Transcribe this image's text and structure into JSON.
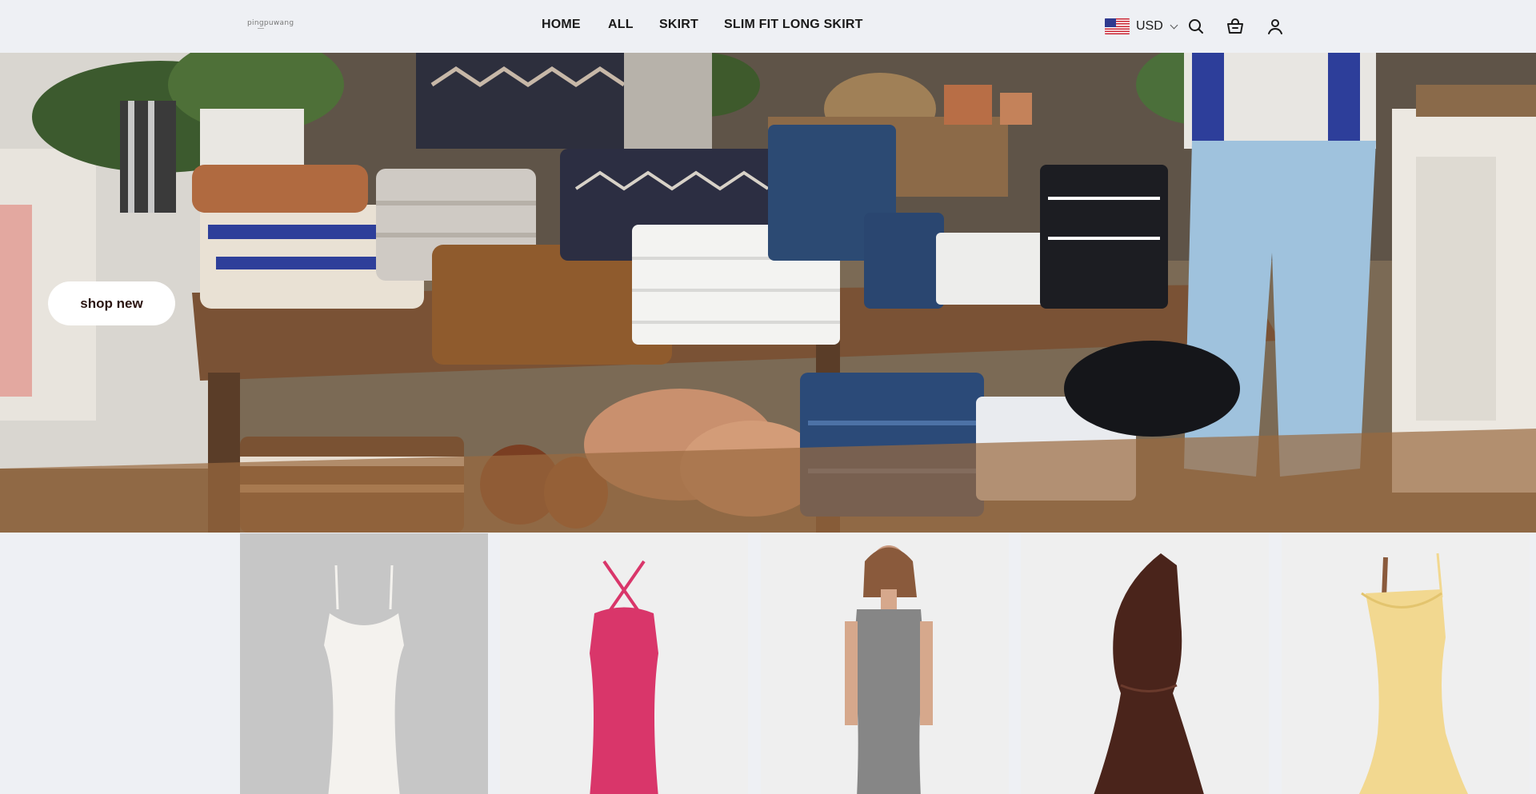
{
  "header": {
    "logo_text": "pingpuwang",
    "nav": [
      {
        "label": "HOME"
      },
      {
        "label": "ALL"
      },
      {
        "label": "SKIRT"
      },
      {
        "label": "SLIM FIT LONG SKIRT"
      }
    ],
    "currency": {
      "code": "USD",
      "flag": "us-flag-icon"
    },
    "icons": [
      "search-icon",
      "cart-icon",
      "account-icon"
    ]
  },
  "hero": {
    "cta_label": "shop new",
    "image": "clothing-store-display-photo"
  },
  "products": [
    {
      "image": "white-knit-slip-dress",
      "color": "#f4f2ee"
    },
    {
      "image": "pink-cable-knit-halter-dress",
      "color": "#d9366a"
    },
    {
      "image": "grey-asymmetric-dress-model",
      "color": "#868686"
    },
    {
      "image": "brown-one-shoulder-satin-dress",
      "color": "#4a241b"
    },
    {
      "image": "yellow-cowl-neck-satin-dress",
      "color": "#f2d890"
    }
  ],
  "colors": {
    "background": "#eef0f4",
    "text": "#1a1a1a",
    "button_bg": "#ffffff",
    "button_text": "#2a1410"
  }
}
